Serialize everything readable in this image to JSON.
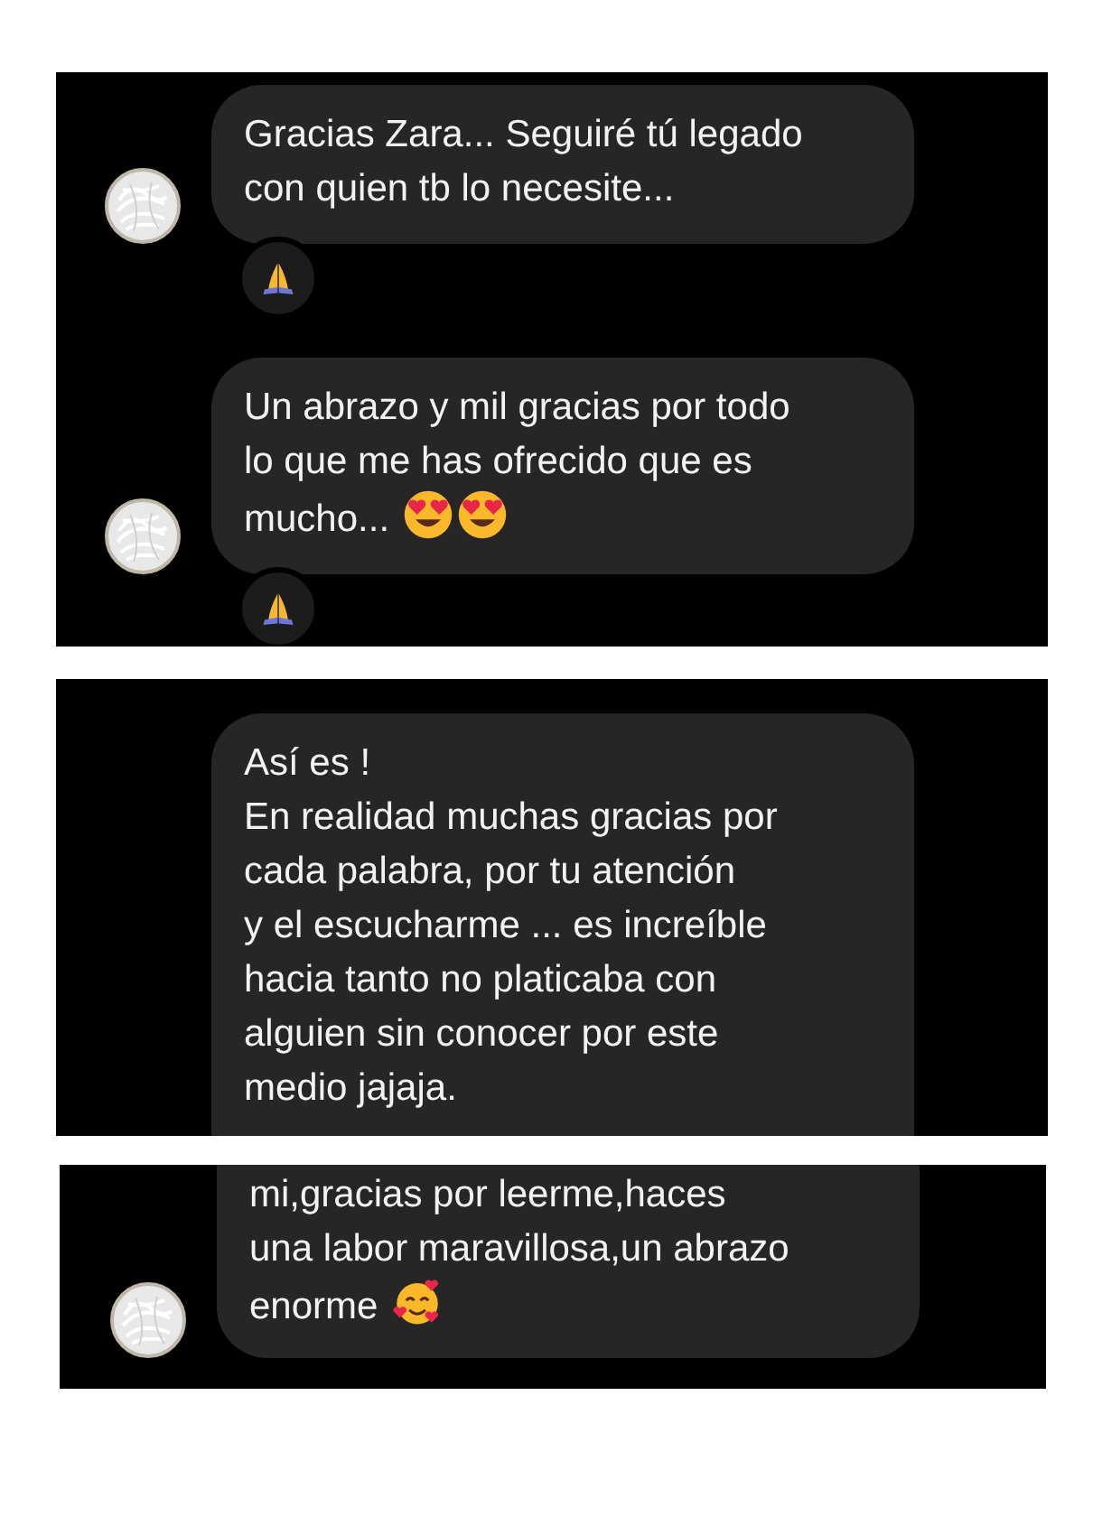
{
  "panels": [
    {
      "messages": [
        {
          "text": "Gracias Zara... Seguiré tú legado\ncon quien tb lo necesite...",
          "avatar": true,
          "reaction": {
            "kind": "praying_hands"
          }
        },
        {
          "text": "Un abrazo y mil gracias por todo\nlo que me has ofrecido que es\nmucho...",
          "avatar": true,
          "emojis": [
            {
              "kind": "heart_eyes"
            },
            {
              "kind": "heart_eyes"
            }
          ],
          "reaction": {
            "kind": "praying_hands"
          }
        }
      ]
    },
    {
      "messages": [
        {
          "text": "Así es !\nEn realidad muchas gracias por\ncada palabra, por tu atención\ny el escucharme ... es increíble\nhacia tanto no platicaba con\nalguien sin conocer por este\nmedio jajaja.",
          "avatar": false,
          "cut_bottom": true
        }
      ]
    },
    {
      "messages": [
        {
          "text": "mi,gracias por leerme,haces\nuna labor maravillosa,un abrazo\nenorme",
          "avatar": true,
          "emojis": [
            {
              "kind": "smiling_hearts"
            }
          ],
          "cut_top": true
        }
      ]
    }
  ]
}
